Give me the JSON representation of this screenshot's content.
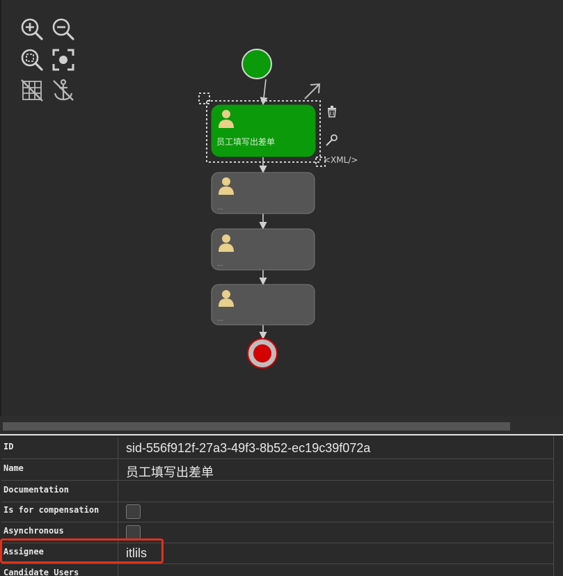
{
  "toolbar": {
    "zoom_in": "zoom-in-icon",
    "zoom_out": "zoom-out-icon",
    "zoom_actual": "zoom-actual-icon",
    "zoom_fit": "zoom-fit-icon",
    "grid": "grid-icon",
    "anchor": "anchor-icon"
  },
  "diagram": {
    "start_event_color": "#0a9a0a",
    "end_event_color": "#d40000",
    "selected_task_color": "#0a9a0a",
    "task_color": "#555555",
    "tasks": [
      {
        "label": "员工填写出差单",
        "selected": true
      },
      {
        "label": "...",
        "selected": false
      },
      {
        "label": "...",
        "selected": false
      },
      {
        "label": "...",
        "selected": false
      }
    ],
    "context_actions": {
      "delete": "trash-icon",
      "edit": "wrench-icon",
      "xml_label": "<XML/>"
    }
  },
  "properties": {
    "rows": [
      {
        "key": "ID",
        "value": "sid-556f912f-27a3-49f3-8b52-ec19c39f072a"
      },
      {
        "key": "Name",
        "value": "员工填写出差单"
      },
      {
        "key": "Documentation",
        "value": ""
      },
      {
        "key": "Is for compensation",
        "checkbox": true
      },
      {
        "key": "Asynchronous",
        "checkbox": true
      },
      {
        "key": "Assignee",
        "value": "itlils"
      },
      {
        "key": "Candidate Users",
        "value": ""
      }
    ]
  }
}
